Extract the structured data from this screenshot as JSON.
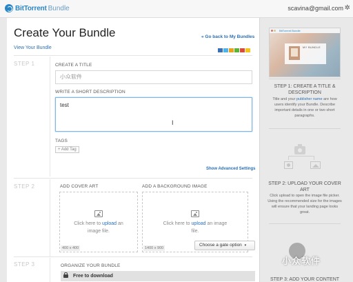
{
  "header": {
    "logo_text": "BitTorrent",
    "logo_sub": "Bundle",
    "user_email": "scavina@gmail.com",
    "gear_glyph": "✲"
  },
  "main": {
    "title": "Create Your Bundle",
    "view_bundle_link": "View Your Bundle",
    "back_link": "« Go back to My Bundles",
    "share_colors": [
      "#3b6fb6",
      "#4fb3e8",
      "#e8a21c",
      "#5bb33a",
      "#d94a3a",
      "#f2c318"
    ],
    "step1": {
      "label": "STEP 1",
      "title_label": "CREATE A TITLE",
      "title_value": "小众软件",
      "desc_label": "WRITE A SHORT DESCRIPTION",
      "desc_value": "test",
      "cursor_glyph": "I",
      "tags_label": "TAGS",
      "add_tag": "+ Add Tag",
      "advanced_link": "Show Advanced Settings"
    },
    "step2": {
      "label": "STEP 2",
      "cover_label": "ADD COVER ART",
      "background_label": "ADD A BACKGROUND IMAGE",
      "cover": {
        "text_before": "Click here to ",
        "link": "upload",
        "text_after": " an image file.",
        "size": "400 x 400"
      },
      "background": {
        "text_before": "Click here to ",
        "link": "upload",
        "text_after": " an image file.",
        "size": "1400 x 900"
      }
    },
    "step3": {
      "label": "STEP 3",
      "organize_label": "ORGANIZE YOUR BUNDLE",
      "gate_button": "Choose a gate option",
      "gate_caret": "▾",
      "free_label": "Free to download"
    }
  },
  "sidebar": {
    "preview_logo": "BitTorrent Bundle",
    "preview_card_text": "MY BUNDLE",
    "step1_title": "STEP 1: CREATE A TITLE & DESCRIPTION",
    "step1_text_a": "Title and your ",
    "step1_link": "publisher name",
    "step1_text_b": " are how users identify your Bundle. Describe important details in one or two short paragraphs.",
    "step2_title": "STEP 2: UPLOAD YOUR COVER ART",
    "step2_text": "Click upload to open the image file picker. Using the recommended size for the images will ensure that your landing page looks great.",
    "step3_title": "STEP 3: ADD YOUR CONTENT"
  },
  "watermark": {
    "text": "小众软件"
  }
}
